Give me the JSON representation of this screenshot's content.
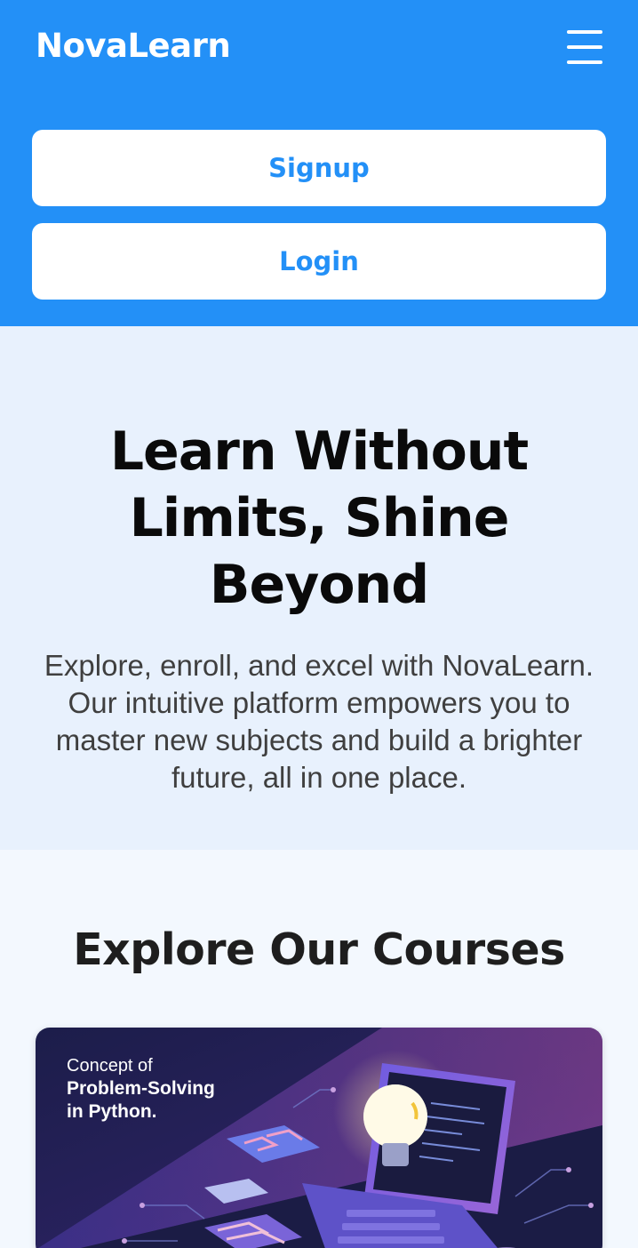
{
  "header": {
    "brand": "NovaLearn",
    "menu_icon": "hamburger-menu-icon",
    "signup_label": "Signup",
    "login_label": "Login"
  },
  "hero": {
    "title": "Learn Without Limits, Shine Beyond",
    "subtitle_line1": "Explore, enroll, and excel with NovaLearn.",
    "subtitle_line2": "Our intuitive platform empowers you to master new subjects and build a brighter future, all in one place."
  },
  "courses": {
    "heading": "Explore Our Courses",
    "items": [
      {
        "concept": "Concept of",
        "title_line1": "Problem-Solving",
        "title_line2": "in Python."
      }
    ]
  },
  "colors": {
    "primary": "#2390f7",
    "hero_bg": "#e8f1fd",
    "courses_bg": "#f3f8fe"
  }
}
